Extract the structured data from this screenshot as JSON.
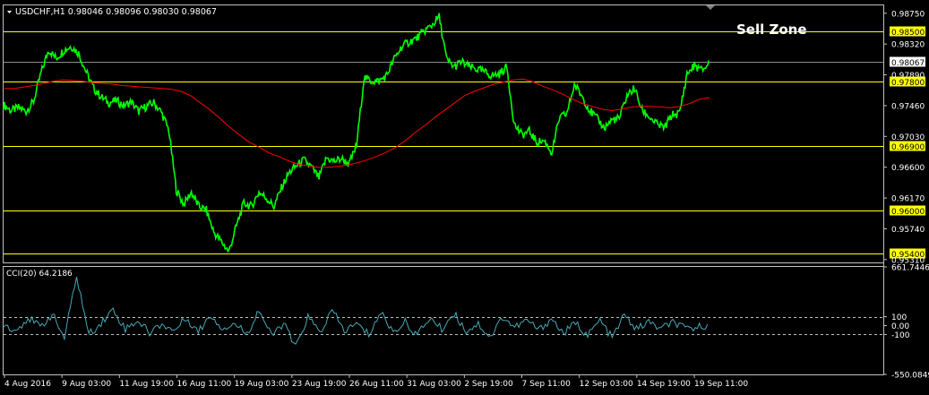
{
  "window": {
    "symbol_line": "USDCHF,H1  0.98046 0.98096 0.98030 0.98067",
    "annotation": "Sell Zone"
  },
  "colors": {
    "background": "#000000",
    "price": "#00ff00",
    "moving_average": "#ff0000",
    "levels": "#ffff00",
    "level_label_bg": "#ffff00",
    "cci": "#49a7b7",
    "text": "#ffffff",
    "axis": "#c0c0c0"
  },
  "chart_data": [
    {
      "type": "line",
      "name": "price-panel",
      "y_ticks": [
        "0.98750",
        "0.98320",
        "0.97890",
        "0.97460",
        "0.97030",
        "0.96600",
        "0.96170",
        "0.95740",
        "0.95310"
      ],
      "ylim": [
        0.9527,
        0.9886
      ],
      "current_price": "0.98067",
      "levels": [
        {
          "value": 0.985,
          "label": "0.98500"
        },
        {
          "value": 0.978,
          "label": "0.97800"
        },
        {
          "value": 0.969,
          "label": "0.96900"
        },
        {
          "value": 0.96,
          "label": "0.96000"
        },
        {
          "value": 0.954,
          "label": "0.95400"
        }
      ],
      "x_labels": [
        "4 Aug 2016",
        "9 Aug 03:00",
        "11 Aug 19:00",
        "16 Aug 11:00",
        "19 Aug 03:00",
        "23 Aug 19:00",
        "26 Aug 11:00",
        "31 Aug 03:00",
        "2 Sep 19:00",
        "7 Sep 11:00",
        "12 Sep 03:00",
        "14 Sep 19:00",
        "19 Sep 11:00"
      ],
      "series": [
        {
          "values": [
            0.9747,
            0.9739,
            0.9743,
            0.9738,
            0.9752,
            0.9792,
            0.9824,
            0.9812,
            0.9823,
            0.9829,
            0.9819,
            0.9793,
            0.977,
            0.9758,
            0.975,
            0.9753,
            0.9746,
            0.9751,
            0.9738,
            0.9745,
            0.975,
            0.9737,
            0.9712,
            0.9628,
            0.9608,
            0.9625,
            0.9605,
            0.96,
            0.9569,
            0.9556,
            0.9542,
            0.9578,
            0.961,
            0.9605,
            0.9625,
            0.9617,
            0.9605,
            0.9631,
            0.9652,
            0.9662,
            0.967,
            0.966,
            0.9645,
            0.9673,
            0.9668,
            0.9672,
            0.9664,
            0.969,
            0.9785,
            0.978,
            0.978,
            0.9788,
            0.9811,
            0.9828,
            0.9835,
            0.984,
            0.985,
            0.9858,
            0.987,
            0.981,
            0.98,
            0.9807,
            0.98,
            0.9797,
            0.9793,
            0.9788,
            0.979,
            0.98,
            0.972,
            0.9705,
            0.971,
            0.9695,
            0.9697,
            0.968,
            0.9728,
            0.9735,
            0.9775,
            0.976,
            0.974,
            0.9728,
            0.9715,
            0.9726,
            0.9728,
            0.976,
            0.977,
            0.974,
            0.973,
            0.972,
            0.9715,
            0.9733,
            0.9735,
            0.979,
            0.9802,
            0.9795,
            0.9806
          ],
          "color": "#00ff00"
        },
        {
          "values": [
            0.977,
            0.977,
            0.9772,
            0.9774,
            0.9777,
            0.978,
            0.9782,
            0.9781,
            0.978,
            0.9778,
            0.9777,
            0.9776,
            0.9774,
            0.9773,
            0.9772,
            0.9771,
            0.977,
            0.9769,
            0.9766,
            0.976,
            0.975,
            0.974,
            0.9728,
            0.9716,
            0.9705,
            0.9695,
            0.9688,
            0.968,
            0.9675,
            0.9669,
            0.9664,
            0.9662,
            0.966,
            0.966,
            0.9661,
            0.9663,
            0.9666,
            0.967,
            0.9675,
            0.9681,
            0.9688,
            0.9698,
            0.9709,
            0.9719,
            0.973,
            0.974,
            0.975,
            0.976,
            0.9766,
            0.9771,
            0.9776,
            0.9779,
            0.9782,
            0.9783,
            0.9779,
            0.9773,
            0.9768,
            0.9762,
            0.9755,
            0.9749,
            0.9745,
            0.9741,
            0.9739,
            0.9741,
            0.9744,
            0.9745,
            0.9745,
            0.9744,
            0.9743,
            0.9745,
            0.9749,
            0.9755,
            0.9757
          ],
          "color": "#ff0000"
        }
      ]
    },
    {
      "type": "line",
      "name": "cci-panel",
      "title": "CCI(20) 64.2186",
      "y_ticks": [
        "661.7446",
        "100",
        "0.00",
        "-100",
        "-550.0849"
      ],
      "ylim": [
        -550.0849,
        661.7446
      ],
      "reference_lines": [
        100,
        -100
      ],
      "series": [
        {
          "values": [
            20,
            -60,
            90,
            -20,
            130,
            -140,
            560,
            -100,
            30,
            180,
            -40,
            60,
            -80,
            20,
            -60,
            90,
            -70,
            120,
            -30,
            20,
            -90,
            180,
            -120,
            30,
            -250,
            100,
            -80,
            170,
            -60,
            20,
            -100,
            150,
            -70,
            40,
            -110,
            90,
            -40,
            140,
            -60,
            20,
            -130,
            100,
            -20,
            60,
            -50,
            80,
            -90,
            30,
            -110,
            60,
            -140,
            120,
            -40,
            40,
            -40,
            40,
            -40,
            -20,
            20
          ],
          "color": "#49a7b7"
        }
      ]
    }
  ]
}
